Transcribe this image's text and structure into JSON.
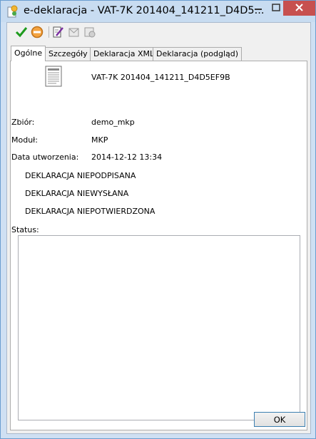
{
  "window": {
    "title": "e-deklaracja - VAT-7K 201404_141211_D4D5..."
  },
  "toolbar": {
    "icons": [
      "checkmark-icon",
      "cancel-icon",
      "edit-sign-icon",
      "send-icon",
      "confirm-icon"
    ]
  },
  "tabs": [
    {
      "label": "Ogólne",
      "active": true
    },
    {
      "label": "Szczegóły",
      "active": false
    },
    {
      "label": "Deklaracja XML",
      "active": false
    },
    {
      "label": "Deklaracja (podgląd)",
      "active": false
    }
  ],
  "general": {
    "document_name": "VAT-7K 201404_141211_D4D5EF9B",
    "fields": [
      {
        "label": "Zbiór:",
        "value": "demo_mkp"
      },
      {
        "label": "Moduł:",
        "value": "MKP"
      },
      {
        "label": "Data utworzenia:",
        "value": "2014-12-12 13:34"
      }
    ],
    "states": [
      "DEKLARACJA NIEPODPISANA",
      "DEKLARACJA NIEWYSŁANA",
      "DEKLARACJA NIEPOTWIERDZONA"
    ],
    "status_label": "Status:",
    "status_text": ""
  },
  "footer": {
    "ok_label": "OK"
  }
}
